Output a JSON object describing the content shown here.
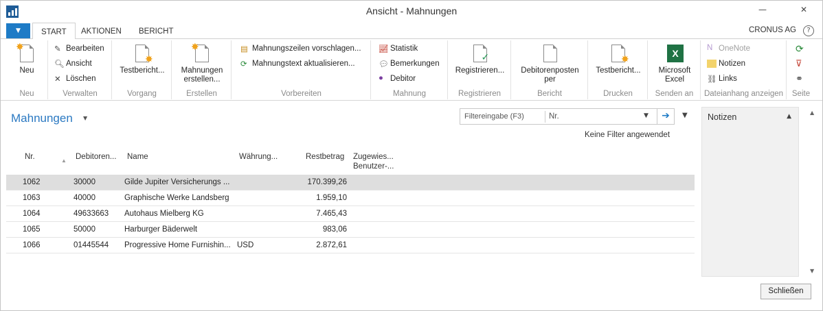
{
  "window": {
    "title": "Ansicht - Mahnungen",
    "minimize_glyph": "—",
    "close_glyph": "✕"
  },
  "tabs": [
    {
      "label": "START"
    },
    {
      "label": "AKTIONEN"
    },
    {
      "label": "BERICHT"
    }
  ],
  "company": "CRONUS AG",
  "help_glyph": "?",
  "ribbon": {
    "neu": {
      "button": "Neu",
      "group": "Neu"
    },
    "verwalten": {
      "bearbeiten": "Bearbeiten",
      "ansicht": "Ansicht",
      "loeschen": "Löschen",
      "group": "Verwalten"
    },
    "vorgang": {
      "button": "Testbericht...",
      "group": "Vorgang"
    },
    "erstellen": {
      "line1": "Mahnungen",
      "line2": "erstellen...",
      "group": "Erstellen"
    },
    "vorbereiten": {
      "zeilen": "Mahnungszeilen vorschlagen...",
      "text": "Mahnungstext aktualisieren...",
      "group": "Vorbereiten"
    },
    "mahnung": {
      "statistik": "Statistik",
      "bemerkungen": "Bemerkungen",
      "debitor": "Debitor",
      "group": "Mahnung"
    },
    "registrieren": {
      "button": "Registrieren...",
      "group": "Registrieren"
    },
    "bericht": {
      "line1": "Debitorenposten",
      "line2": "per",
      "group": "Bericht"
    },
    "drucken": {
      "button": "Testbericht...",
      "group": "Drucken"
    },
    "senden": {
      "line1": "Microsoft",
      "line2": "Excel",
      "group": "Senden an"
    },
    "dateianhang": {
      "onenote": "OneNote",
      "notizen": "Notizen",
      "links": "Links",
      "group": "Dateianhang anzeigen"
    },
    "seite": {
      "group": "Seite"
    }
  },
  "page": {
    "title": "Mahnungen",
    "no_filter": "Keine Filter angewendet"
  },
  "filter": {
    "placeholder": "Filtereingabe (F3)",
    "field": "Nr."
  },
  "columns": {
    "nr": "Nr.",
    "debitor": "Debitoren...",
    "name": "Name",
    "waehrung": "Währung...",
    "restbetrag": "Restbetrag",
    "zugewiesen1": "Zugewies...",
    "zugewiesen2": "Benutzer-..."
  },
  "rows": [
    {
      "nr": "1062",
      "debitor": "30000",
      "name": "Gilde Jupiter Versicherungs ...",
      "waehrung": "",
      "restbetrag": "170.399,26"
    },
    {
      "nr": "1063",
      "debitor": "40000",
      "name": "Graphische Werke Landsberg",
      "waehrung": "",
      "restbetrag": "1.959,10"
    },
    {
      "nr": "1064",
      "debitor": "49633663",
      "name": "Autohaus Mielberg KG",
      "waehrung": "",
      "restbetrag": "7.465,43"
    },
    {
      "nr": "1065",
      "debitor": "50000",
      "name": "Harburger Bäderwelt",
      "waehrung": "",
      "restbetrag": "983,06"
    },
    {
      "nr": "1066",
      "debitor": "01445544",
      "name": "Progressive Home Furnishin...",
      "waehrung": "USD",
      "restbetrag": "2.872,61"
    }
  ],
  "notes_panel": {
    "title": "Notizen"
  },
  "close_button": "Schließen",
  "colors": {
    "accent": "#1e7bc6",
    "title_blue": "#2b79c2",
    "excel_green": "#1f7244"
  }
}
